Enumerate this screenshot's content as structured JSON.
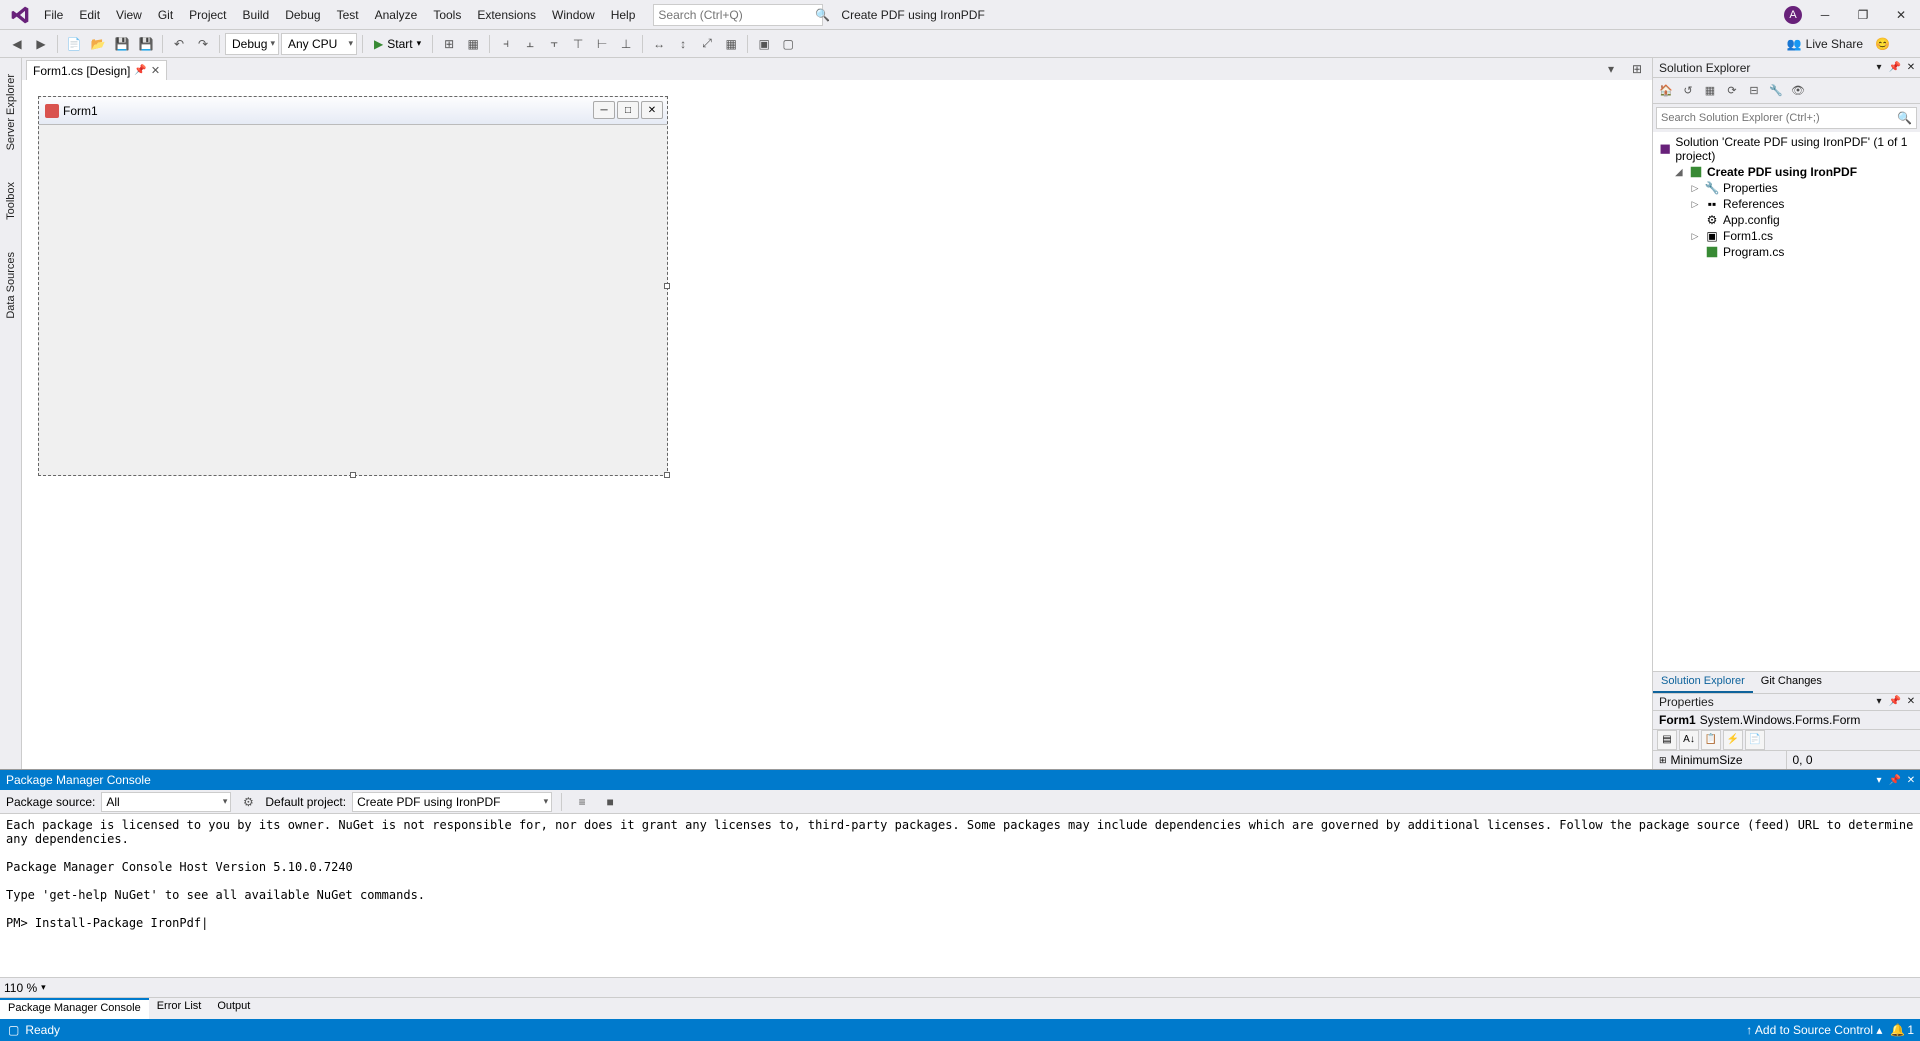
{
  "titlebar": {
    "menus": [
      "File",
      "Edit",
      "View",
      "Git",
      "Project",
      "Build",
      "Debug",
      "Test",
      "Analyze",
      "Tools",
      "Extensions",
      "Window",
      "Help"
    ],
    "search_placeholder": "Search (Ctrl+Q)",
    "window_title": "Create PDF using IronPDF",
    "avatar_initial": "A"
  },
  "toolbar": {
    "config": "Debug",
    "platform": "Any CPU",
    "start": "Start",
    "liveshare": "Live Share"
  },
  "left_gutter": [
    "Server Explorer",
    "Toolbox",
    "Data Sources"
  ],
  "doc_tab": {
    "label": "Form1.cs [Design]"
  },
  "form_designer": {
    "title": "Form1"
  },
  "solution_explorer": {
    "title": "Solution Explorer",
    "search_placeholder": "Search Solution Explorer (Ctrl+;)",
    "root": "Solution 'Create PDF using IronPDF' (1 of 1 project)",
    "project": "Create PDF using IronPDF",
    "items": [
      "Properties",
      "References",
      "App.config",
      "Form1.cs",
      "Program.cs"
    ],
    "tabs": [
      "Solution Explorer",
      "Git Changes"
    ]
  },
  "properties": {
    "title": "Properties",
    "object_name": "Form1",
    "object_type": "System.Windows.Forms.Form",
    "row_name": "MinimumSize",
    "row_value": "0, 0"
  },
  "console": {
    "title": "Package Manager Console",
    "package_source_label": "Package source:",
    "package_source_value": "All",
    "default_project_label": "Default project:",
    "default_project_value": "Create PDF using IronPDF",
    "body": "Each package is licensed to you by its owner. NuGet is not responsible for, nor does it grant any licenses to, third-party packages. Some packages may include dependencies which are governed by additional licenses. Follow the package source (feed) URL to determine any dependencies.\n\nPackage Manager Console Host Version 5.10.0.7240\n\nType 'get-help NuGet' to see all available NuGet commands.\n\nPM> Install-Package IronPdf|",
    "zoom": "110 %",
    "tabs": [
      "Package Manager Console",
      "Error List",
      "Output"
    ]
  },
  "statusbar": {
    "status": "Ready",
    "source_control": "Add to Source Control",
    "notifications": "1"
  }
}
